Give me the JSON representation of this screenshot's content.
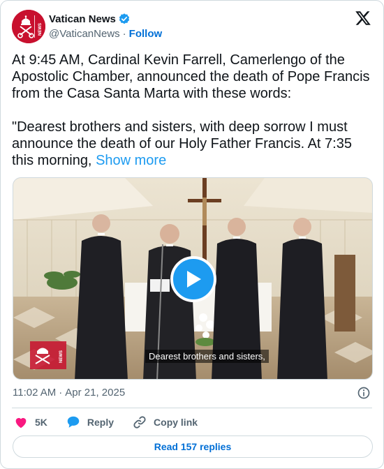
{
  "author": {
    "display_name": "Vatican News",
    "handle": "@VaticanNews",
    "separator": "·",
    "follow_label": "Follow",
    "avatar_badge": "NEWS",
    "brand_color": "#c8102e",
    "verified_color": "#1d9bf0"
  },
  "tweet": {
    "text": "At 9:45 AM, Cardinal Kevin Farrell, Camerlengo of the Apostolic Chamber, announced the death of Pope Francis from the Casa Santa Marta with these words:\n\n\"Dearest brothers and sisters, with deep sorrow I must announce the death of our Holy Father Francis. At 7:35 this morning, ",
    "show_more_label": "Show more"
  },
  "media": {
    "type": "video",
    "caption": "Dearest brothers and sisters,",
    "play_icon": "play-icon",
    "watermark_badge": "NEWS"
  },
  "meta": {
    "time": "11:02 AM",
    "separator": "·",
    "date": "Apr 21, 2025"
  },
  "actions": {
    "likes_count": "5K",
    "reply_label": "Reply",
    "copy_link_label": "Copy link",
    "like_color": "#f91880",
    "reply_color": "#1d9bf0"
  },
  "footer": {
    "read_replies_label": "Read 157 replies"
  }
}
